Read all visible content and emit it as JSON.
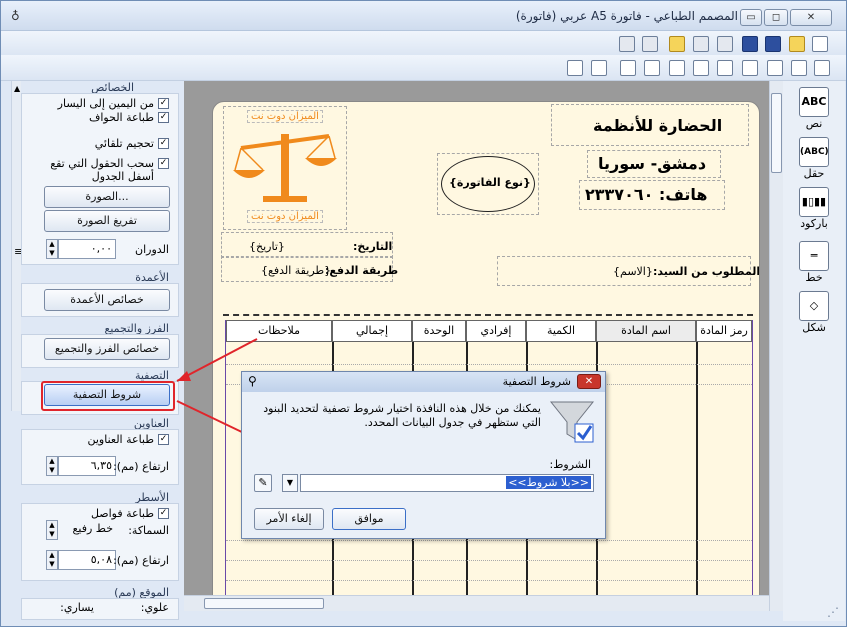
{
  "window": {
    "title": "المصمم الطباعي - فاتورة A5 عربي (فاتورة)",
    "min": "▭",
    "max": "◻",
    "close": "✕"
  },
  "left_panel": {
    "properties": {
      "title": "الخصائص",
      "rtl": "من اليمين إلى اليسار",
      "print_borders": "طباعة الحواف",
      "auto_size": "تحجيم تلقائي",
      "drag_fields": "سحب الحقول التي تقع أسفل الجدول",
      "image_btn": "الصورة...",
      "clear_image_btn": "تفريغ الصورة",
      "rotation_label": "الدوران",
      "rotation_value": "٠,٠٠"
    },
    "columns": {
      "title": "الأعمدة",
      "btn": "خصائص الأعمدة"
    },
    "sort": {
      "title": "الفرز والتجميع",
      "btn": "خصائص الفرز والتجميع"
    },
    "filter": {
      "title": "التصفية",
      "btn": "شروط التصفية"
    },
    "headers": {
      "title": "العناوين",
      "print": "طباعة العناوين",
      "height_label": "ارتفاع (مم):",
      "height_value": "٦,٣٥"
    },
    "lines": {
      "title": "الأسطر",
      "print": "طباعة فواصل",
      "thickness_label": "السماكة:",
      "thickness_value": "خط رفيع",
      "height_label": "ارتفاع (مم):",
      "height_value": "٥,٠٨"
    },
    "position": {
      "title": "الموقع (مم)",
      "top_label": "علوي:",
      "left_label": "يساري:"
    }
  },
  "invoice": {
    "company": "الحضارة للأنظمة",
    "city": "دمشق- سوريا",
    "phone": "هاتف: ٢٣٣٧٠٦٠",
    "logo_text_top": "الميزان دوت نت",
    "logo_text_bottom": "الميزان دوت نت",
    "type": "{نوع الفاتورة}",
    "date_label": "التاريخ:",
    "date_value": "{تاريخ}",
    "payment_label": "طريقة الدفع:",
    "payment_value": "{طريقة الدفع}",
    "customer_label": "المطلوب من السيد:",
    "customer_value": "{الاسم}",
    "columns": [
      "رمز المادة",
      "اسم المادة",
      "الكمية",
      "إفرادي",
      "الوحدة",
      "إجمالي",
      "ملاحظات"
    ]
  },
  "right_tools": [
    {
      "icon": "ABC",
      "label": "نص"
    },
    {
      "icon": "(ABC)",
      "label": "حقل"
    },
    {
      "icon": "▮▯▮▮",
      "label": "باركود"
    },
    {
      "icon": "═",
      "label": "خط"
    },
    {
      "icon": "◇",
      "label": "شكل"
    }
  ],
  "dialog": {
    "title": "شروط التصفية",
    "description": "يمكنك من خلال هذه النافذة اختيار شروط تصفية لتحديد البنود التي ستظهر في جدول البيانات المحدد.",
    "conditions_label": "الشروط:",
    "conditions_value": "<<بلا شروط>>",
    "ok": "موافق",
    "cancel": "إلغاء الأمر"
  },
  "colors": {
    "accent": "#e0252b",
    "selected": "#2c5fd0",
    "logo": "#f08a1c"
  }
}
